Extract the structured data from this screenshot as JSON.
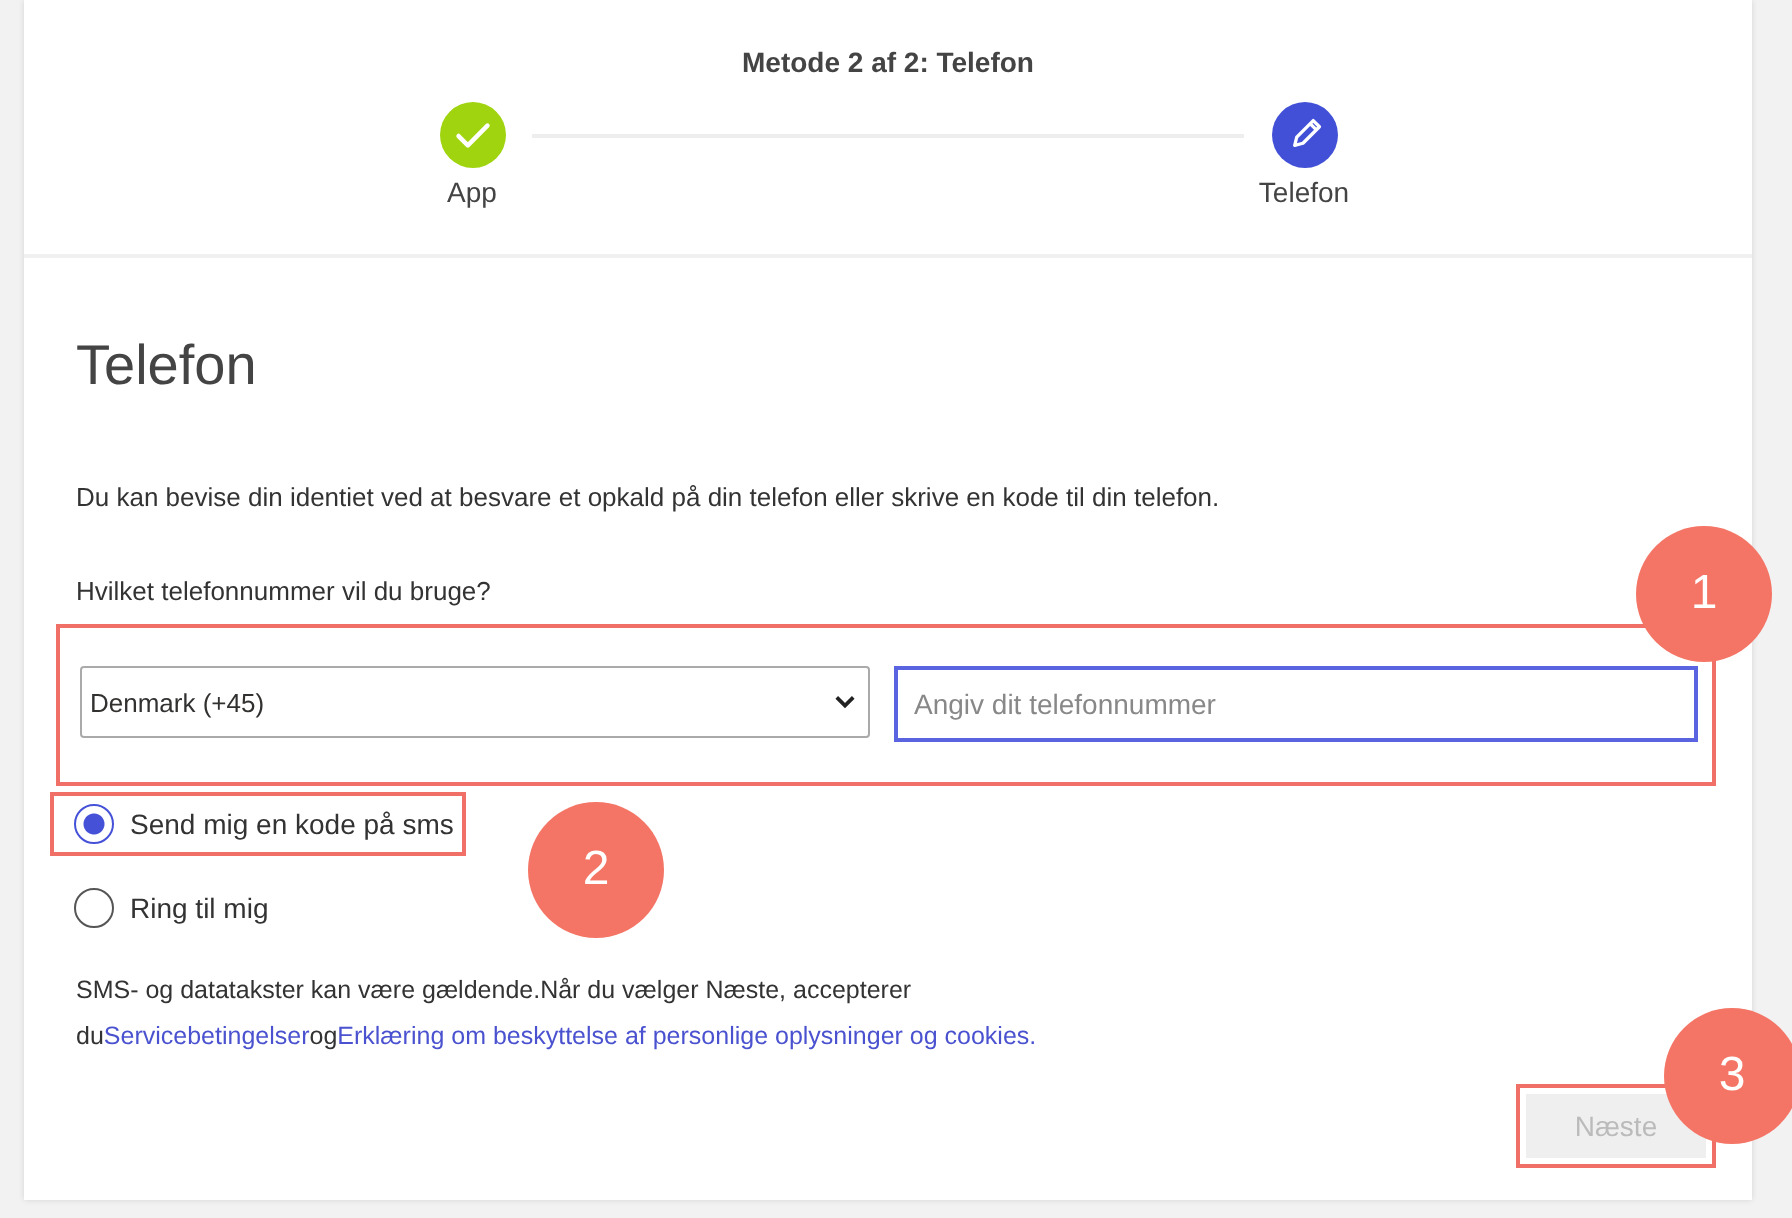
{
  "progress": {
    "title": "Metode 2 af 2: Telefon",
    "steps": [
      {
        "label": "App",
        "completed": true
      },
      {
        "label": "Telefon",
        "completed": false
      }
    ]
  },
  "heading": "Telefon",
  "intro": "Du kan bevise din identiet ved at besvare et opkald på din telefon eller skrive en kode til din telefon.",
  "question": "Hvilket telefonnummer vil du bruge?",
  "phone_fields": {
    "callout": "1",
    "country": "Denmark (+45)",
    "number_placeholder": "Angiv dit telefonnummer"
  },
  "methods": [
    {
      "label": "Send mig en kode på sms",
      "selected": true,
      "callout": "2"
    },
    {
      "label": "Ring til mig",
      "selected": false
    }
  ],
  "legal": {
    "text": "SMS- og datatakster kan være gældende.Når du vælger Næste, accepterer du",
    "link_1": "Servicebetingelser",
    "joiner": "og",
    "link_2": "Erklæring om beskyttelse af personlige oplysninger og cookies."
  },
  "next_button": {
    "label": "Næste",
    "disabled": true,
    "callout": "3"
  }
}
